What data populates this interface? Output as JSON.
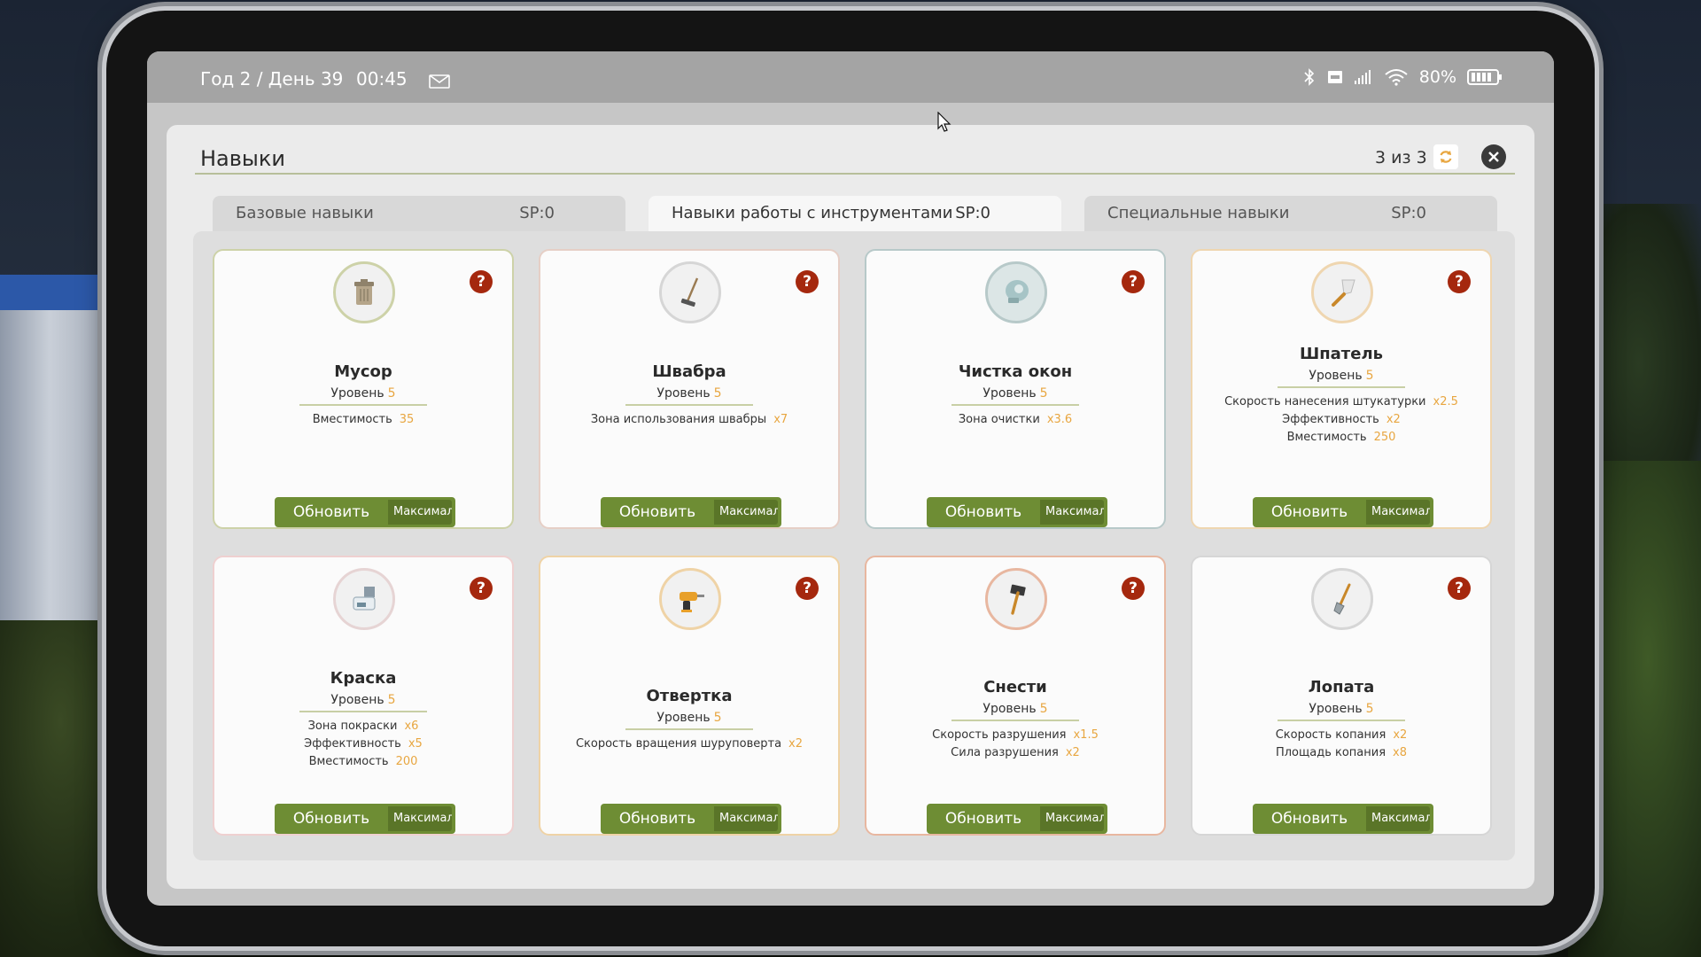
{
  "statusbar": {
    "date": "Год 2 / День 39",
    "time": "00:45",
    "battery": "80%"
  },
  "panel": {
    "title": "Навыки",
    "page_count": "3 из 3"
  },
  "tabs": [
    {
      "label": "Базовые навыки",
      "sp": "SP:0"
    },
    {
      "label": "Навыки работы с инструментами",
      "sp": "SP:0"
    },
    {
      "label": "Специальные навыки",
      "sp": "SP:0"
    }
  ],
  "cards": [
    {
      "name": "Мусор",
      "level_label": "Уровень",
      "level": "5",
      "icon": "trash-can-icon",
      "stats": [
        {
          "label": "Вместимость",
          "value": "35"
        }
      ],
      "update": "Обновить",
      "max": "Максимальный"
    },
    {
      "name": "Швабра",
      "level_label": "Уровень",
      "level": "5",
      "icon": "mop-icon",
      "stats": [
        {
          "label": "Зона использования швабры",
          "value": "x7"
        }
      ],
      "update": "Обновить",
      "max": "Максимальный"
    },
    {
      "name": "Чистка окон",
      "level_label": "Уровень",
      "level": "5",
      "icon": "window-cleaner-icon",
      "stats": [
        {
          "label": "Зона очистки",
          "value": "x3.6"
        }
      ],
      "update": "Обновить",
      "max": "Максимальный"
    },
    {
      "name": "Шпатель",
      "level_label": "Уровень",
      "level": "5",
      "icon": "spatula-icon",
      "stats": [
        {
          "label": "Скорость нанесения штукатурки",
          "value": "x2.5"
        },
        {
          "label": "Эффективность",
          "value": "x2"
        },
        {
          "label": "Вместимость",
          "value": "250"
        }
      ],
      "update": "Обновить",
      "max": "Максимальный"
    },
    {
      "name": "Краска",
      "level_label": "Уровень",
      "level": "5",
      "icon": "paint-bucket-icon",
      "stats": [
        {
          "label": "Зона покраски",
          "value": "x6"
        },
        {
          "label": "Эффективность",
          "value": "x5"
        },
        {
          "label": "Вместимость",
          "value": "200"
        }
      ],
      "update": "Обновить",
      "max": "Максимальный"
    },
    {
      "name": "Отвертка",
      "level_label": "Уровень",
      "level": "5",
      "icon": "drill-icon",
      "stats": [
        {
          "label": "Скорость вращения шуруповерта",
          "value": "x2"
        }
      ],
      "update": "Обновить",
      "max": "Максимальный"
    },
    {
      "name": "Снести",
      "level_label": "Уровень",
      "level": "5",
      "icon": "sledgehammer-icon",
      "stats": [
        {
          "label": "Скорость разрушения",
          "value": "x1.5"
        },
        {
          "label": "Сила разрушения",
          "value": "x2"
        }
      ],
      "update": "Обновить",
      "max": "Максимальный"
    },
    {
      "name": "Лопата",
      "level_label": "Уровень",
      "level": "5",
      "icon": "shovel-icon",
      "stats": [
        {
          "label": "Скорость копания",
          "value": "x2"
        },
        {
          "label": "Площадь копания",
          "value": "x8"
        }
      ],
      "update": "Обновить",
      "max": "Максимальный"
    }
  ],
  "colors": {
    "button_green": "#6e8d34",
    "value_orange": "#e8a640",
    "help_red": "#a5280e"
  }
}
